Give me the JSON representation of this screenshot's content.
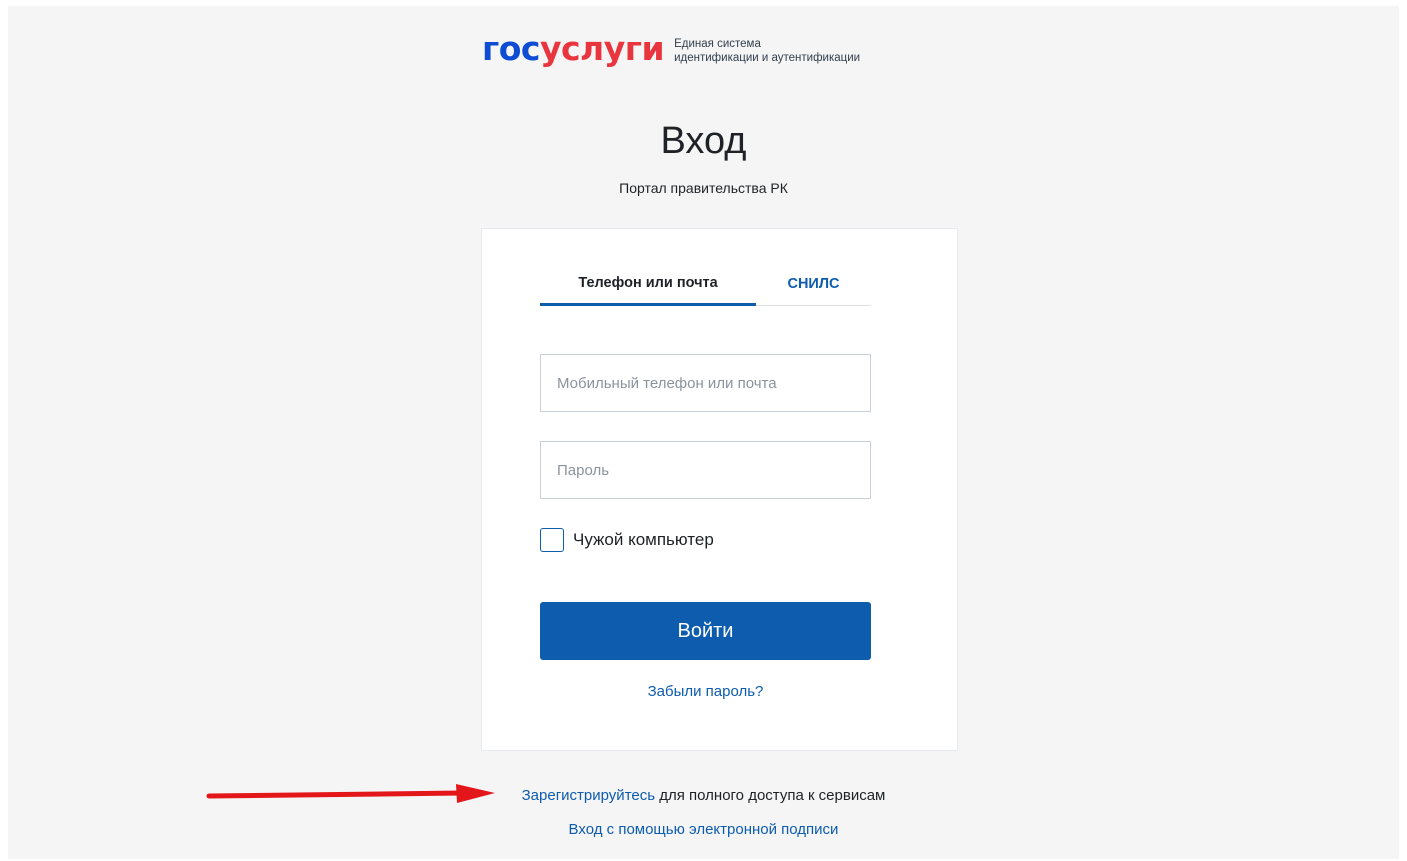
{
  "header": {
    "logo_part1": "гос",
    "logo_part2": "услуги",
    "caption_line1": "Единая система",
    "caption_line2": "идентификации и аутентификации"
  },
  "title": "Вход",
  "subtitle": "Портал правительства РК",
  "tabs": [
    {
      "label": "Телефон или почта",
      "active": true
    },
    {
      "label": "СНИЛС",
      "active": false
    }
  ],
  "form": {
    "login_placeholder": "Мобильный телефон или почта",
    "password_placeholder": "Пароль",
    "checkbox_label": "Чужой компьютер",
    "checkbox_checked": false,
    "submit_label": "Войти",
    "forgot_label": "Забыли пароль?"
  },
  "footer": {
    "register_link": "Зарегистрируйтесь",
    "register_rest": " для полного доступа к сервисам",
    "esign_label": "Вход с помощью электронной подписи"
  },
  "annotation": {
    "arrow_icon": "red-arrow-right-icon",
    "arrow_color": "#e3161a"
  },
  "colors": {
    "brand_blue": "#0d5cae",
    "logo_blue": "#0d4cd3",
    "logo_red": "#e8353e",
    "page_bg": "#f5f5f5"
  }
}
